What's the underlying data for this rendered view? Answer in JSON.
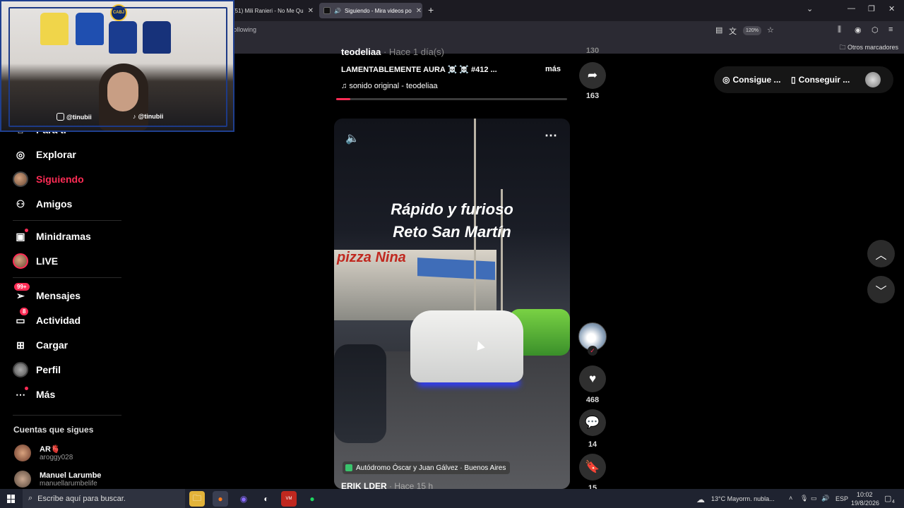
{
  "browser": {
    "tabs": [
      {
        "label": "(51) Mili Ranieri - No Me Qu"
      },
      {
        "label": "Siguiendo - Mira videos po"
      }
    ],
    "url": "m/following",
    "zoom": "120%",
    "bookmarks_other": "Otros marcadores"
  },
  "webcam": {
    "badge": "CABJ",
    "instagram": "@tinubii",
    "tiktok": "@tinubii"
  },
  "sidebar": {
    "items": [
      {
        "label": "Para ti",
        "icon": "home-icon"
      },
      {
        "label": "Explorar",
        "icon": "compass-icon"
      },
      {
        "label": "Siguiendo",
        "icon": "following-avatar"
      },
      {
        "label": "Amigos",
        "icon": "friends-icon"
      },
      {
        "label": "Minidramas",
        "icon": "film-icon"
      },
      {
        "label": "LIVE",
        "icon": "live-avatar"
      },
      {
        "label": "Mensajes",
        "icon": "send-icon",
        "badge": "99+"
      },
      {
        "label": "Actividad",
        "icon": "activity-icon",
        "badge": "8"
      },
      {
        "label": "Cargar",
        "icon": "plus-box-icon"
      },
      {
        "label": "Perfil",
        "icon": "profile-avatar"
      },
      {
        "label": "Más",
        "icon": "more-icon"
      }
    ],
    "accounts_heading": "Cuentas que sigues",
    "accounts": [
      {
        "name": "AR🫀",
        "handle": "aroggy028"
      },
      {
        "name": "Manuel Larumbe",
        "handle": "manuellarumbelife"
      }
    ]
  },
  "upper_post": {
    "user": "teodeliaa",
    "time": "· Hace 1 día(s)",
    "description": "LAMENTABLEMENTE AURA ☠️ ☠️ #412 ...",
    "more": "más",
    "sound": "sonido original - teodeliaa",
    "share_count": "163",
    "prev_count": "130",
    "progress": 0.06
  },
  "video": {
    "caption_line1": "Rápido y furioso",
    "caption_line2": "Reto San Martín",
    "shop_sign": "pizza Nina",
    "location": "Autódromo Óscar y Juan Gálvez · Buenos Aires",
    "user": "ERIK LDER",
    "time": "· Hace 15 h"
  },
  "actions": {
    "likes": "468",
    "comments": "14",
    "saves": "15"
  },
  "top_pills": {
    "coins": "Consigue ...",
    "app": "Conseguir ..."
  },
  "taskbar": {
    "search_placeholder": "Escribe aquí para buscar.",
    "weather": "13°C  Mayorm. nubla...",
    "lang": "ESP",
    "time": "10:02",
    "date": "19/8/2026",
    "notifications": "4"
  },
  "colors": {
    "accent": "#fe2c55",
    "background": "#000000",
    "browser_chrome": "#2b2a33"
  }
}
